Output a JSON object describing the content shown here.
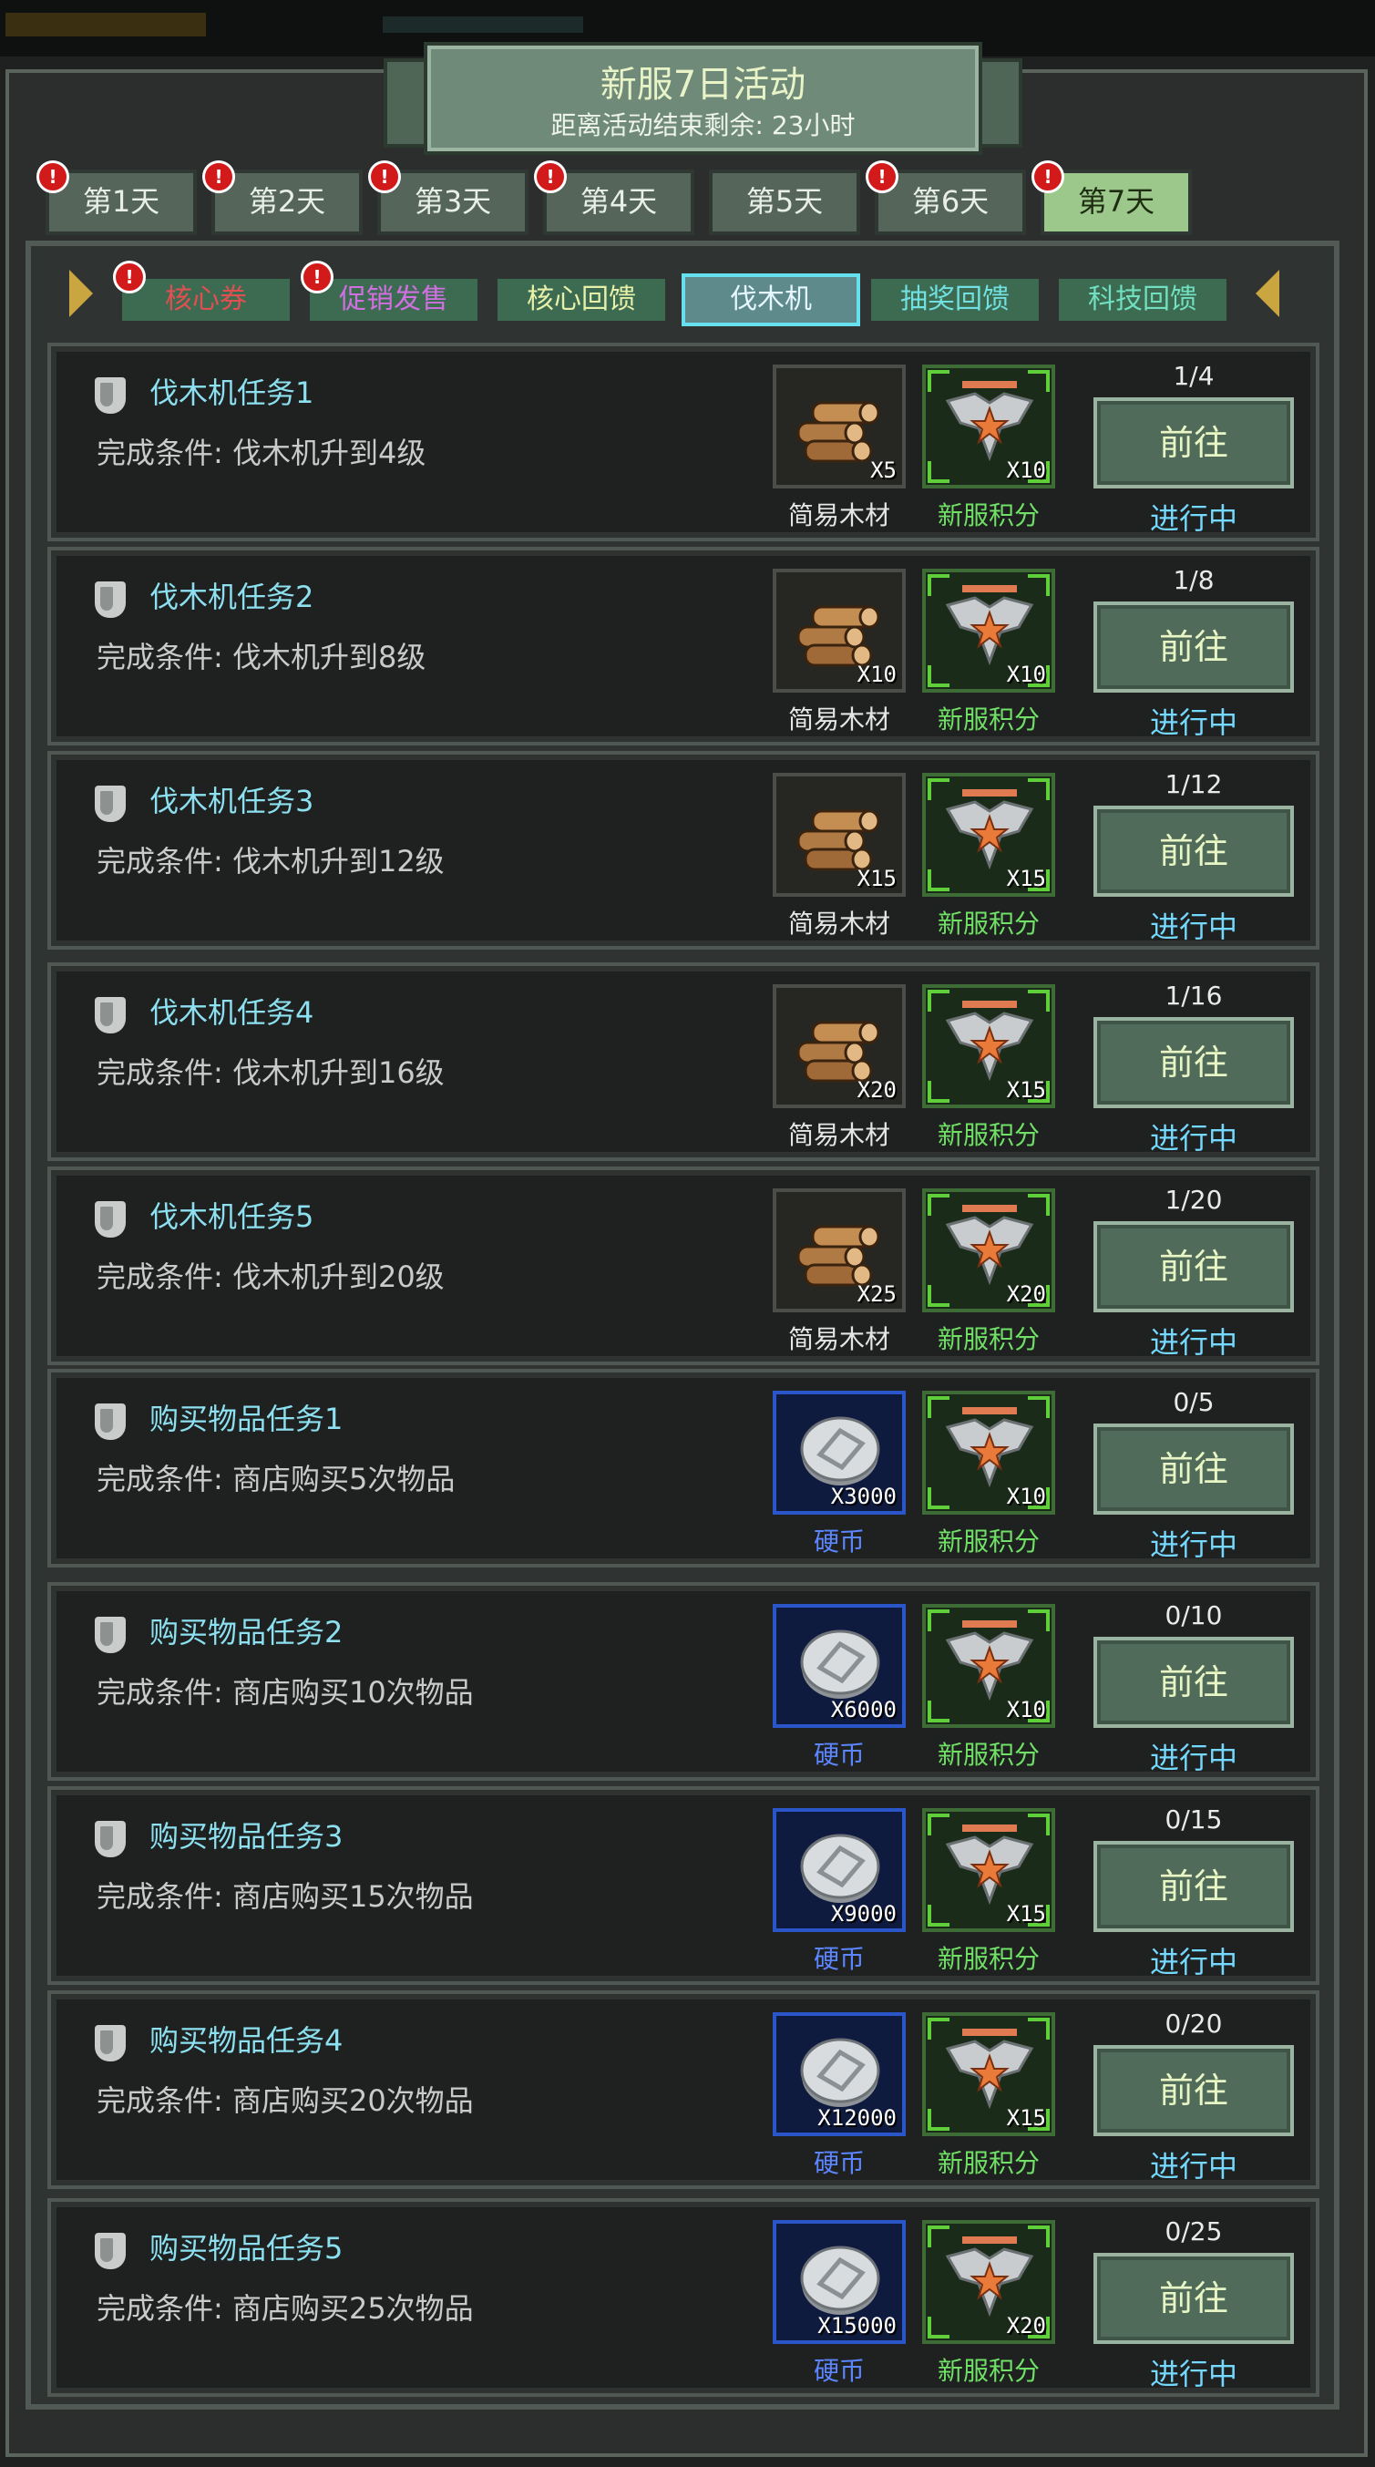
{
  "header": {
    "title": "新服7日活动",
    "subtitle": "距离活动结束剩余: 23小时"
  },
  "day_tabs": [
    {
      "label": "第1天",
      "alert": true,
      "active": false
    },
    {
      "label": "第2天",
      "alert": true,
      "active": false
    },
    {
      "label": "第3天",
      "alert": true,
      "active": false
    },
    {
      "label": "第4天",
      "alert": true,
      "active": false
    },
    {
      "label": "第5天",
      "alert": false,
      "active": false
    },
    {
      "label": "第6天",
      "alert": true,
      "active": false
    },
    {
      "label": "第7天",
      "alert": true,
      "active": true
    }
  ],
  "sub_tabs": [
    {
      "label": "核心券",
      "alert": true,
      "active": false,
      "color": "#e05050"
    },
    {
      "label": "促销发售",
      "alert": true,
      "active": false,
      "color": "#d070e0"
    },
    {
      "label": "核心回馈",
      "alert": false,
      "active": false,
      "color": "#e7f0a8"
    },
    {
      "label": "伐木机",
      "alert": false,
      "active": true,
      "color": "#e6f8ff"
    },
    {
      "label": "抽奖回馈",
      "alert": false,
      "active": false,
      "color": "#70e0e0"
    },
    {
      "label": "科技回馈",
      "alert": false,
      "active": false,
      "color": "#70e0c0"
    }
  ],
  "alert_mark": "!",
  "item_names": {
    "wood": "简易木材",
    "coin": "硬币",
    "badge": "新服积分"
  },
  "go_label": "前往",
  "status_label": "进行中",
  "tasks": [
    {
      "name": "伐木机任务1",
      "condition": "完成条件: 伐木机升到4级",
      "reward1": {
        "type": "wood",
        "qty": "X5"
      },
      "reward2": {
        "type": "badge",
        "qty": "X10"
      },
      "progress": "1/4"
    },
    {
      "name": "伐木机任务2",
      "condition": "完成条件: 伐木机升到8级",
      "reward1": {
        "type": "wood",
        "qty": "X10"
      },
      "reward2": {
        "type": "badge",
        "qty": "X10"
      },
      "progress": "1/8"
    },
    {
      "name": "伐木机任务3",
      "condition": "完成条件: 伐木机升到12级",
      "reward1": {
        "type": "wood",
        "qty": "X15"
      },
      "reward2": {
        "type": "badge",
        "qty": "X15"
      },
      "progress": "1/12"
    },
    {
      "name": "伐木机任务4",
      "condition": "完成条件: 伐木机升到16级",
      "reward1": {
        "type": "wood",
        "qty": "X20"
      },
      "reward2": {
        "type": "badge",
        "qty": "X15"
      },
      "progress": "1/16"
    },
    {
      "name": "伐木机任务5",
      "condition": "完成条件: 伐木机升到20级",
      "reward1": {
        "type": "wood",
        "qty": "X25"
      },
      "reward2": {
        "type": "badge",
        "qty": "X20"
      },
      "progress": "1/20"
    },
    {
      "name": "购买物品任务1",
      "condition": "完成条件: 商店购买5次物品",
      "reward1": {
        "type": "coin",
        "qty": "X3000"
      },
      "reward2": {
        "type": "badge",
        "qty": "X10"
      },
      "progress": "0/5"
    },
    {
      "name": "购买物品任务2",
      "condition": "完成条件: 商店购买10次物品",
      "reward1": {
        "type": "coin",
        "qty": "X6000"
      },
      "reward2": {
        "type": "badge",
        "qty": "X10"
      },
      "progress": "0/10"
    },
    {
      "name": "购买物品任务3",
      "condition": "完成条件: 商店购买15次物品",
      "reward1": {
        "type": "coin",
        "qty": "X9000"
      },
      "reward2": {
        "type": "badge",
        "qty": "X15"
      },
      "progress": "0/15"
    },
    {
      "name": "购买物品任务4",
      "condition": "完成条件: 商店购买20次物品",
      "reward1": {
        "type": "coin",
        "qty": "X12000"
      },
      "reward2": {
        "type": "badge",
        "qty": "X15"
      },
      "progress": "0/20"
    },
    {
      "name": "购买物品任务5",
      "condition": "完成条件: 商店购买25次物品",
      "reward1": {
        "type": "coin",
        "qty": "X15000"
      },
      "reward2": {
        "type": "badge",
        "qty": "X20"
      },
      "progress": "0/25"
    }
  ]
}
